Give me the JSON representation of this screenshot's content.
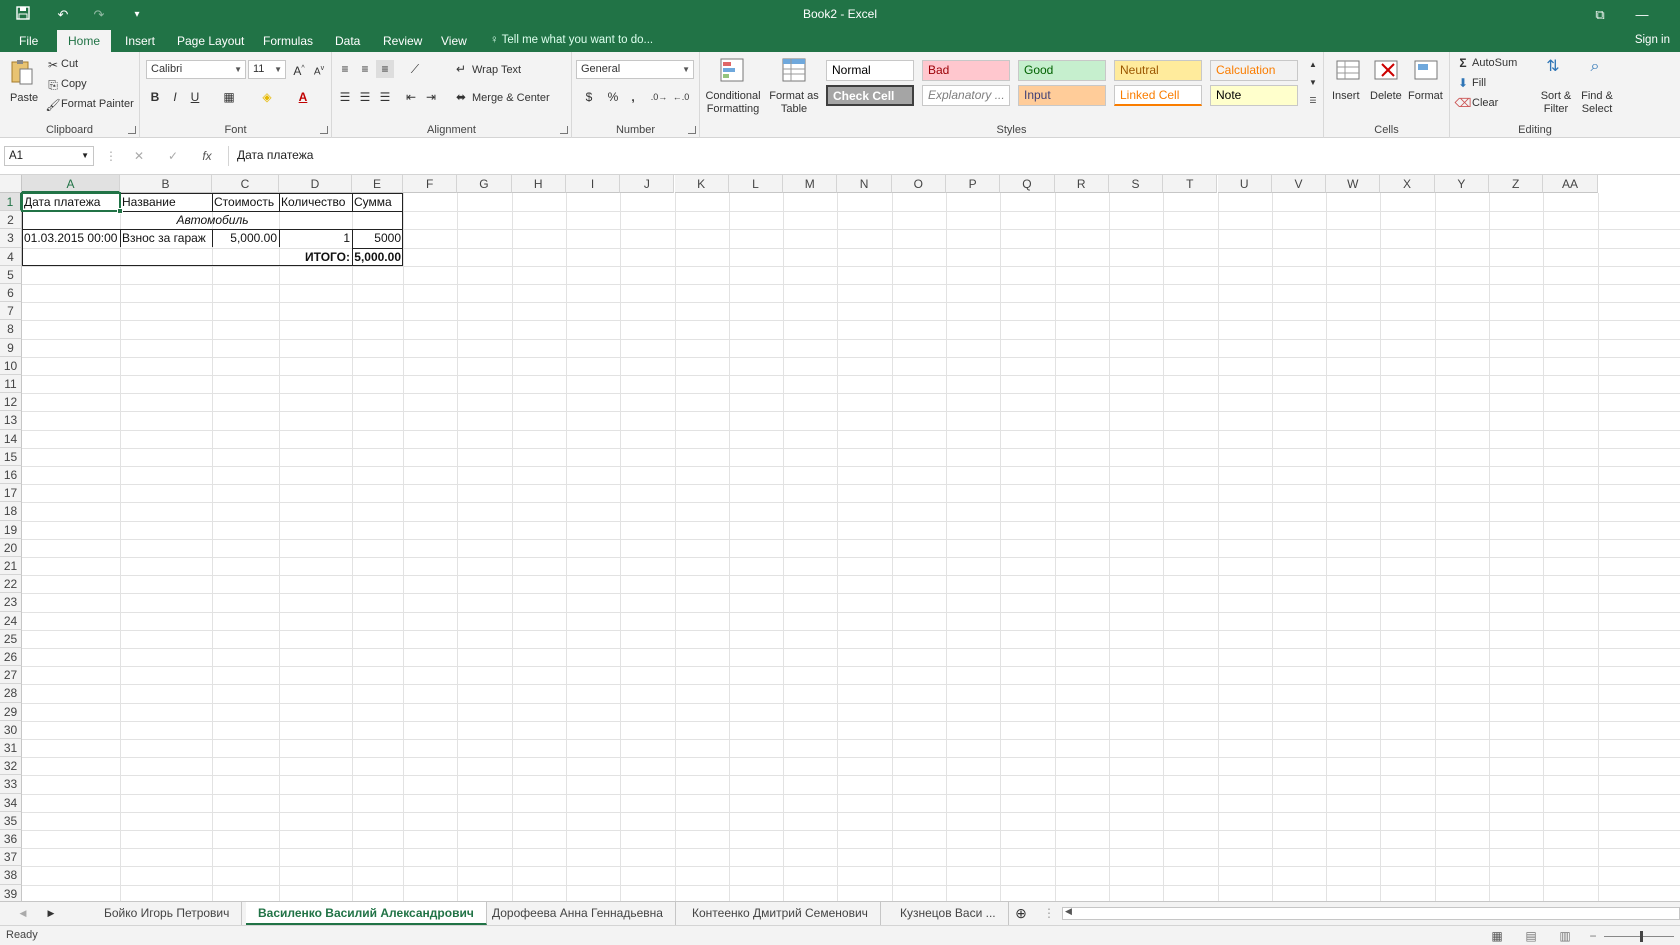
{
  "window": {
    "title": "Book2 - Excel"
  },
  "ribbon_tabs": [
    {
      "label": "File",
      "active": false
    },
    {
      "label": "Home",
      "active": true
    },
    {
      "label": "Insert",
      "active": false
    },
    {
      "label": "Page Layout",
      "active": false
    },
    {
      "label": "Formulas",
      "active": false
    },
    {
      "label": "Data",
      "active": false
    },
    {
      "label": "Review",
      "active": false
    },
    {
      "label": "View",
      "active": false
    }
  ],
  "tell_me": "Tell me what you want to do...",
  "sign_in": "Sign in",
  "clipboard": {
    "paste": "Paste",
    "cut": "Cut",
    "copy": "Copy",
    "format_painter": "Format Painter",
    "label": "Clipboard"
  },
  "font": {
    "name": "Calibri",
    "size": "11",
    "label": "Font",
    "bold": "B",
    "italic": "I",
    "underline": "U"
  },
  "alignment": {
    "wrap_text": "Wrap Text",
    "merge_center": "Merge & Center",
    "label": "Alignment"
  },
  "number": {
    "format": "General",
    "label": "Number",
    "currency": "$",
    "percent": "%",
    "comma": ","
  },
  "styles_group": {
    "conditional": "Conditional Formatting",
    "format_as_table": "Format as Table",
    "label": "Styles",
    "cells": [
      {
        "label": "Normal",
        "bg": "#ffffff",
        "color": "#000000"
      },
      {
        "label": "Bad",
        "bg": "#ffc7ce",
        "color": "#9c0006"
      },
      {
        "label": "Good",
        "bg": "#c6efce",
        "color": "#006100"
      },
      {
        "label": "Neutral",
        "bg": "#ffeb9c",
        "color": "#9c5700"
      },
      {
        "label": "Calculation",
        "bg": "#f2f2f2",
        "color": "#fa7d00"
      },
      {
        "label": "Check Cell",
        "bg": "#a5a5a5",
        "color": "#ffffff"
      },
      {
        "label": "Explanatory ...",
        "bg": "#ffffff",
        "color": "#7f7f7f"
      },
      {
        "label": "Input",
        "bg": "#ffcc99",
        "color": "#3f3f76"
      },
      {
        "label": "Linked Cell",
        "bg": "#ffffff",
        "color": "#fa7d00"
      },
      {
        "label": "Note",
        "bg": "#ffffcc",
        "color": "#000000"
      }
    ]
  },
  "cells_group": {
    "insert": "Insert",
    "delete": "Delete",
    "format": "Format",
    "label": "Cells"
  },
  "editing": {
    "autosum": "AutoSum",
    "fill": "Fill",
    "clear": "Clear",
    "sort_filter": "Sort & Filter",
    "find_select": "Find & Select",
    "label": "Editing"
  },
  "formula_bar": {
    "name_box": "A1",
    "fx": "fx",
    "content": "Дата платежа"
  },
  "grid": {
    "columns": [
      "A",
      "B",
      "C",
      "D",
      "E",
      "F",
      "G",
      "H",
      "I",
      "J",
      "K",
      "L",
      "M",
      "N",
      "O",
      "P",
      "Q",
      "R",
      "S",
      "T",
      "U",
      "V",
      "W",
      "X",
      "Y",
      "Z",
      "AA"
    ],
    "rows": [
      "1",
      "2",
      "3",
      "4",
      "5",
      "6",
      "7",
      "8",
      "9",
      "10",
      "11",
      "12",
      "13",
      "14",
      "15",
      "16",
      "17",
      "18",
      "19",
      "20",
      "21",
      "22",
      "23",
      "24",
      "25",
      "26",
      "27",
      "28",
      "29",
      "30",
      "31",
      "32",
      "33",
      "34",
      "35",
      "36",
      "37",
      "38",
      "39"
    ],
    "selected_cell": "A1",
    "cells": {
      "a1": "Дата платежа",
      "b1": "Название",
      "c1": "Стоимость",
      "d1": "Количество",
      "e1": "Сумма",
      "a2": "Автомобиль",
      "a3": "01.03.2015 00:00",
      "b3": "Взнос за гараж",
      "c3": "5,000.00",
      "d3": "1",
      "e3": "5000",
      "d4": "ИТОГО:",
      "e4": "5,000.00"
    }
  },
  "sheets": [
    {
      "label": "Бойко Игорь Петрович",
      "active": false
    },
    {
      "label": "Василенко Василий Александрович",
      "active": true
    },
    {
      "label": "Дорофеева Анна Геннадьевна",
      "active": false
    },
    {
      "label": "Контеенко Дмитрий Семенович",
      "active": false
    },
    {
      "label": "Кузнецов Васи ...",
      "active": false
    }
  ],
  "status": {
    "text": "Ready"
  }
}
